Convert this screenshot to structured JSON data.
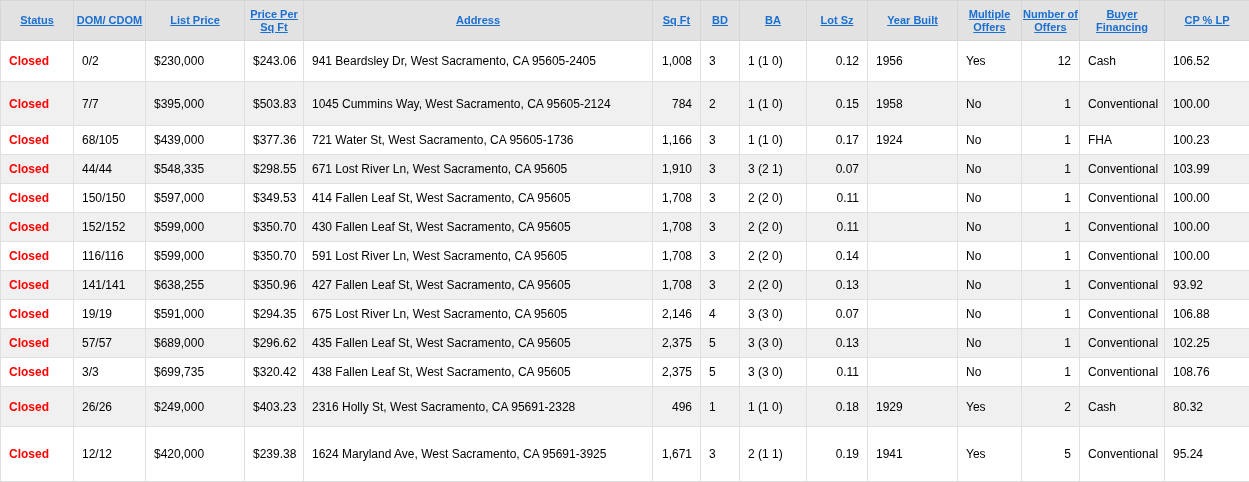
{
  "table": {
    "columns": [
      {
        "label": "Status"
      },
      {
        "label": "DOM/ CDOM"
      },
      {
        "label": "List Price"
      },
      {
        "label": "Price Per Sq Ft"
      },
      {
        "label": "Address"
      },
      {
        "label": "Sq Ft"
      },
      {
        "label": "BD"
      },
      {
        "label": "BA"
      },
      {
        "label": "Lot Sz"
      },
      {
        "label": "Year Built"
      },
      {
        "label": "Multiple Offers"
      },
      {
        "label": "Number of Offers"
      },
      {
        "label": "Buyer Financing"
      },
      {
        "label": "CP % LP"
      }
    ],
    "rows": [
      {
        "cells": [
          "Closed",
          "0/2",
          "$230,000",
          "$243.06",
          "941 Beardsley Dr, West Sacramento, CA 95605-2405",
          "1,008",
          "3",
          "1 (1 0)",
          "0.12",
          "1956",
          "Yes",
          "12",
          "Cash",
          "106.52"
        ]
      },
      {
        "cells": [
          "Closed",
          "7/7",
          "$395,000",
          "$503.83",
          "1045 Cummins Way, West Sacramento, CA 95605-2124",
          "784",
          "2",
          "1 (1 0)",
          "0.15",
          "1958",
          "No",
          "1",
          "Conventional",
          "100.00"
        ]
      },
      {
        "cells": [
          "Closed",
          "68/105",
          "$439,000",
          "$377.36",
          "721 Water St, West Sacramento, CA 95605-1736",
          "1,166",
          "3",
          "1 (1 0)",
          "0.17",
          "1924",
          "No",
          "1",
          "FHA",
          "100.23"
        ]
      },
      {
        "cells": [
          "Closed",
          "44/44",
          "$548,335",
          "$298.55",
          "671 Lost River Ln, West Sacramento, CA 95605",
          "1,910",
          "3",
          "3 (2 1)",
          "0.07",
          "",
          "No",
          "1",
          "Conventional",
          "103.99"
        ]
      },
      {
        "cells": [
          "Closed",
          "150/150",
          "$597,000",
          "$349.53",
          "414 Fallen Leaf St, West Sacramento, CA 95605",
          "1,708",
          "3",
          "2 (2 0)",
          "0.11",
          "",
          "No",
          "1",
          "Conventional",
          "100.00"
        ]
      },
      {
        "cells": [
          "Closed",
          "152/152",
          "$599,000",
          "$350.70",
          "430 Fallen Leaf St, West Sacramento, CA 95605",
          "1,708",
          "3",
          "2 (2 0)",
          "0.11",
          "",
          "No",
          "1",
          "Conventional",
          "100.00"
        ]
      },
      {
        "cells": [
          "Closed",
          "116/116",
          "$599,000",
          "$350.70",
          "591 Lost River Ln, West Sacramento, CA 95605",
          "1,708",
          "3",
          "2 (2 0)",
          "0.14",
          "",
          "No",
          "1",
          "Conventional",
          "100.00"
        ]
      },
      {
        "cells": [
          "Closed",
          "141/141",
          "$638,255",
          "$350.96",
          "427 Fallen Leaf St, West Sacramento, CA 95605",
          "1,708",
          "3",
          "2 (2 0)",
          "0.13",
          "",
          "No",
          "1",
          "Conventional",
          "93.92"
        ]
      },
      {
        "cells": [
          "Closed",
          "19/19",
          "$591,000",
          "$294.35",
          "675 Lost River Ln, West Sacramento, CA 95605",
          "2,146",
          "4",
          "3 (3 0)",
          "0.07",
          "",
          "No",
          "1",
          "Conventional",
          "106.88"
        ]
      },
      {
        "cells": [
          "Closed",
          "57/57",
          "$689,000",
          "$296.62",
          "435 Fallen Leaf St, West Sacramento, CA 95605",
          "2,375",
          "5",
          "3 (3 0)",
          "0.13",
          "",
          "No",
          "1",
          "Conventional",
          "102.25"
        ]
      },
      {
        "cells": [
          "Closed",
          "3/3",
          "$699,735",
          "$320.42",
          "438 Fallen Leaf St, West Sacramento, CA 95605",
          "2,375",
          "5",
          "3 (3 0)",
          "0.11",
          "",
          "No",
          "1",
          "Conventional",
          "108.76"
        ]
      },
      {
        "cells": [
          "Closed",
          "26/26",
          "$249,000",
          "$403.23",
          "2316 Holly St, West Sacramento, CA 95691-2328",
          "496",
          "1",
          "1 (1 0)",
          "0.18",
          "1929",
          "Yes",
          "2",
          "Cash",
          "80.32"
        ]
      },
      {
        "cells": [
          "Closed",
          "12/12",
          "$420,000",
          "$239.38",
          "1624 Maryland Ave, West Sacramento, CA 95691-3925",
          "1,671",
          "3",
          "2 (1 1)",
          "0.19",
          "1941",
          "Yes",
          "5",
          "Conventional",
          "95.24"
        ]
      }
    ]
  }
}
